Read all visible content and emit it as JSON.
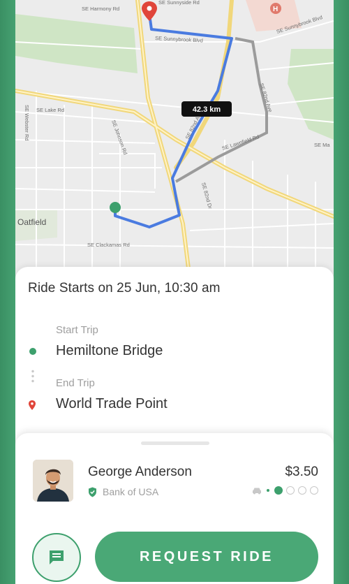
{
  "map": {
    "distance_badge": "42.3 km",
    "place_label": "Oatfield",
    "street_labels": {
      "harmony": "SE Harmony Rd",
      "sunnyside": "SE Sunnyside Rd",
      "sunnybrook_left": "SE Sunnybrook Blvd",
      "sunnybrook_right": "SE Sunnybrook Blvd",
      "lake": "SE Lake Rd",
      "webster": "SE Webster Rd",
      "johnson": "SE Johnson Rd",
      "clackamas": "SE Clackamas Rd",
      "freeway": "SE 82nd Ave",
      "eighty_second": "SE 82nd Dr",
      "sunnyside_ave": "SE 82nd Ave",
      "lawnfield": "SE Lawnfield Rd",
      "se_ma": "SE Ma"
    },
    "colors": {
      "route": "#4a7be0",
      "alt_route": "#9b9b9b",
      "highway": "#f1d77a",
      "start_pin": "#3da06d",
      "end_pin": "#e0453a"
    }
  },
  "ride": {
    "title": "Ride Starts on 25 Jun, 10:30 am",
    "start_label": "Start Trip",
    "start_value": "Hemiltone Bridge",
    "end_label": "End Trip",
    "end_value": "World Trade Point"
  },
  "driver": {
    "name": "George Anderson",
    "price": "$3.50",
    "bank": "Bank of USA",
    "seats_taken": 1,
    "seats_total": 4
  },
  "actions": {
    "request_label": "REQUEST RIDE",
    "chat_icon": "chat-icon"
  },
  "colors": {
    "accent": "#4aa876",
    "frame": "#3f9a6b"
  }
}
